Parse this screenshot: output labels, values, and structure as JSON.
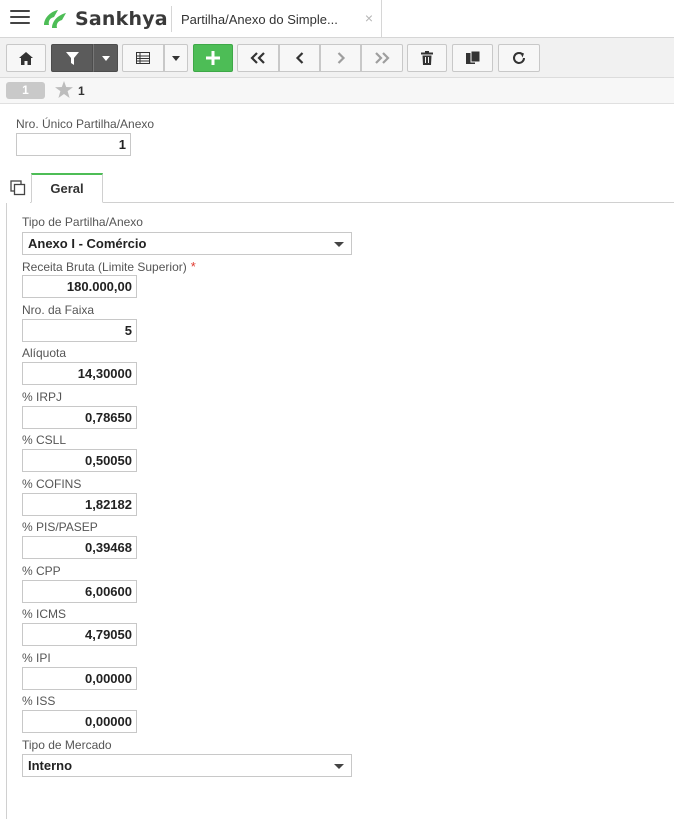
{
  "app": {
    "brand": "Sankhya",
    "brand_color": "#4dbd56",
    "tab_title": "Partilha/Anexo do Simple...",
    "tab_close": "×"
  },
  "toolbar": {
    "buttons": [
      {
        "name": "home-button",
        "icon": "home-icon"
      },
      {
        "name": "filter-button",
        "icon": "filter-icon"
      },
      {
        "name": "filter-dropdown-button",
        "icon": "caret-down-icon"
      },
      {
        "name": "grid-view-button",
        "icon": "grid-icon"
      },
      {
        "name": "grid-view-dropdown-button",
        "icon": "caret-down-icon"
      },
      {
        "name": "add-button",
        "icon": "plus-icon"
      },
      {
        "name": "first-record-button",
        "icon": "double-chevron-left-icon"
      },
      {
        "name": "previous-record-button",
        "icon": "chevron-left-icon"
      },
      {
        "name": "next-record-button",
        "icon": "chevron-right-icon"
      },
      {
        "name": "last-record-button",
        "icon": "double-chevron-right-icon"
      },
      {
        "name": "delete-button",
        "icon": "trash-icon"
      },
      {
        "name": "duplicate-button",
        "icon": "copy-icon"
      },
      {
        "name": "refresh-button",
        "icon": "refresh-icon"
      }
    ]
  },
  "record_nav": {
    "current": "1",
    "favorites_count": "1"
  },
  "header": {
    "nro_label": "Nro. Único Partilha/Anexo",
    "nro_value": "1"
  },
  "tabs": [
    {
      "label": "Geral",
      "active": true
    }
  ],
  "form": {
    "tipo_partilha_label": "Tipo de Partilha/Anexo",
    "tipo_partilha_value": "Anexo I - Comércio",
    "receita_label": "Receita Bruta (Limite Superior)",
    "receita_required": "*",
    "receita_value": "180.000,00",
    "faixa_label": "Nro. da Faixa",
    "faixa_value": "5",
    "aliquota_label": "Alíquota",
    "aliquota_value": "14,30000",
    "irpj_label": "% IRPJ",
    "irpj_value": "0,78650",
    "csll_label": "% CSLL",
    "csll_value": "0,50050",
    "cofins_label": "% COFINS",
    "cofins_value": "1,82182",
    "pis_label": "% PIS/PASEP",
    "pis_value": "0,39468",
    "cpp_label": "% CPP",
    "cpp_value": "6,00600",
    "icms_label": "% ICMS",
    "icms_value": "4,79050",
    "ipi_label": "% IPI",
    "ipi_value": "0,00000",
    "iss_label": "% ISS",
    "iss_value": "0,00000",
    "mercado_label": "Tipo de Mercado",
    "mercado_value": "Interno"
  }
}
